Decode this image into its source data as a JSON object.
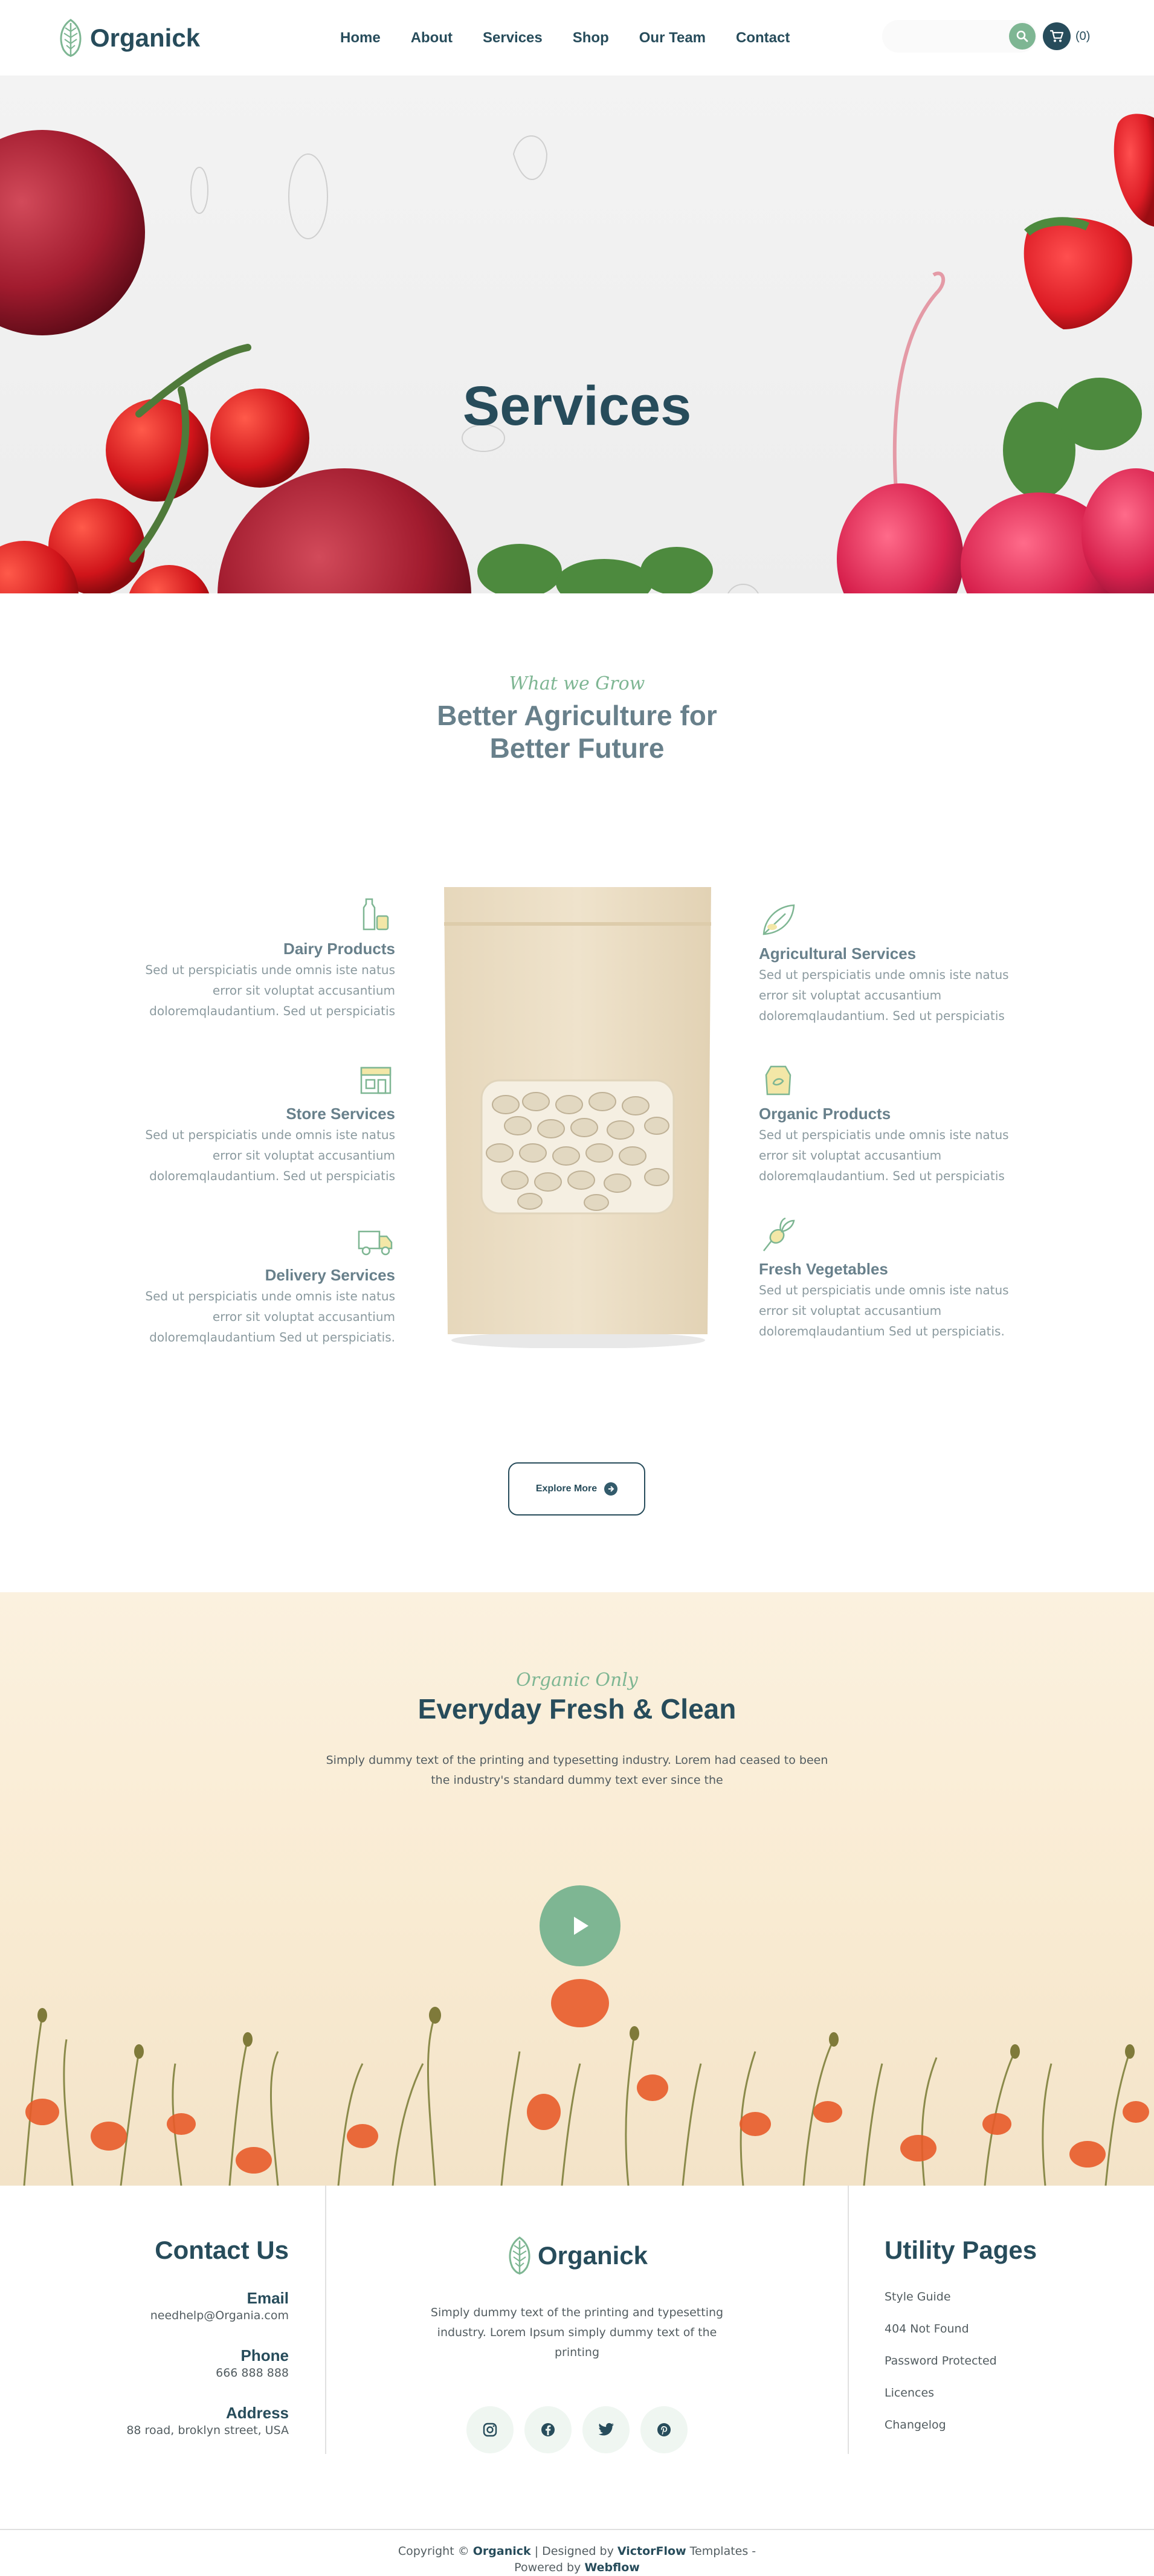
{
  "header": {
    "logo_text": "Organick",
    "nav": [
      "Home",
      "About",
      "Services",
      "Shop",
      "Our Team",
      "Contact"
    ],
    "search_placeholder": "",
    "cart_label": "(0)"
  },
  "hero": {
    "title": "Services"
  },
  "services": {
    "script": "What we Grow",
    "title_line1": "Better Agriculture for",
    "title_line2": "Better Future",
    "left": [
      {
        "icon": "milk-bottle-icon",
        "title": "Dairy Products",
        "desc": "Sed ut perspiciatis unde omnis iste natus error sit voluptat accusantium doloremqlaudantium. Sed ut perspiciatis"
      },
      {
        "icon": "store-icon",
        "title": "Store Services",
        "desc": "Sed ut perspiciatis unde omnis iste natus error sit voluptat accusantium doloremqlaudantium. Sed ut perspiciatis"
      },
      {
        "icon": "truck-icon",
        "title": "Delivery Services",
        "desc": "Sed ut perspiciatis unde omnis iste natus error sit voluptat accusantium doloremqlaudantium Sed ut perspiciatis."
      }
    ],
    "right": [
      {
        "icon": "leaf-icon",
        "title": "Agricultural Services",
        "desc": "Sed ut perspiciatis unde omnis iste natus error sit voluptat accusantium doloremqlaudantium. Sed ut perspiciatis"
      },
      {
        "icon": "organic-bag-icon",
        "title": "Organic Products",
        "desc": "Sed ut perspiciatis unde omnis iste natus error sit voluptat accusantium doloremqlaudantium. Sed ut perspiciatis"
      },
      {
        "icon": "radish-icon",
        "title": "Fresh Vegetables",
        "desc": "Sed ut perspiciatis unde omnis iste natus error sit voluptat accusantium doloremqlaudantium Sed ut perspiciatis."
      }
    ],
    "explore_label": "Explore More"
  },
  "fresh": {
    "script": "Organic Only",
    "title": "Everyday Fresh & Clean",
    "desc": "Simply dummy text of the printing and typesetting industry. Lorem had ceased to been the industry's standard dummy text ever since the"
  },
  "footer": {
    "contact": {
      "title": "Contact Us",
      "email_label": "Email",
      "email": "needhelp@Organia.com",
      "phone_label": "Phone",
      "phone": "666 888 888",
      "address_label": "Address",
      "address": "88 road, broklyn street, USA"
    },
    "center": {
      "logo_text": "Organick",
      "about": "Simply dummy text of the printing and typesetting industry. Lorem Ipsum simply dummy text of the printing"
    },
    "utility": {
      "title": "Utility Pages",
      "links": [
        "Style Guide",
        "404 Not Found",
        "Password Protected",
        "Licences",
        "Changelog"
      ]
    },
    "copyright": {
      "prefix": "Copyright ©",
      "brand": "Organick",
      "designed": "| Designed by",
      "designer": "VictorFlow",
      "templates": "Templates -",
      "powered": "Powered by",
      "platform": "Webflow"
    }
  },
  "colors": {
    "primary": "#274c5b",
    "accent": "#7eb693",
    "muted": "#68808b"
  }
}
